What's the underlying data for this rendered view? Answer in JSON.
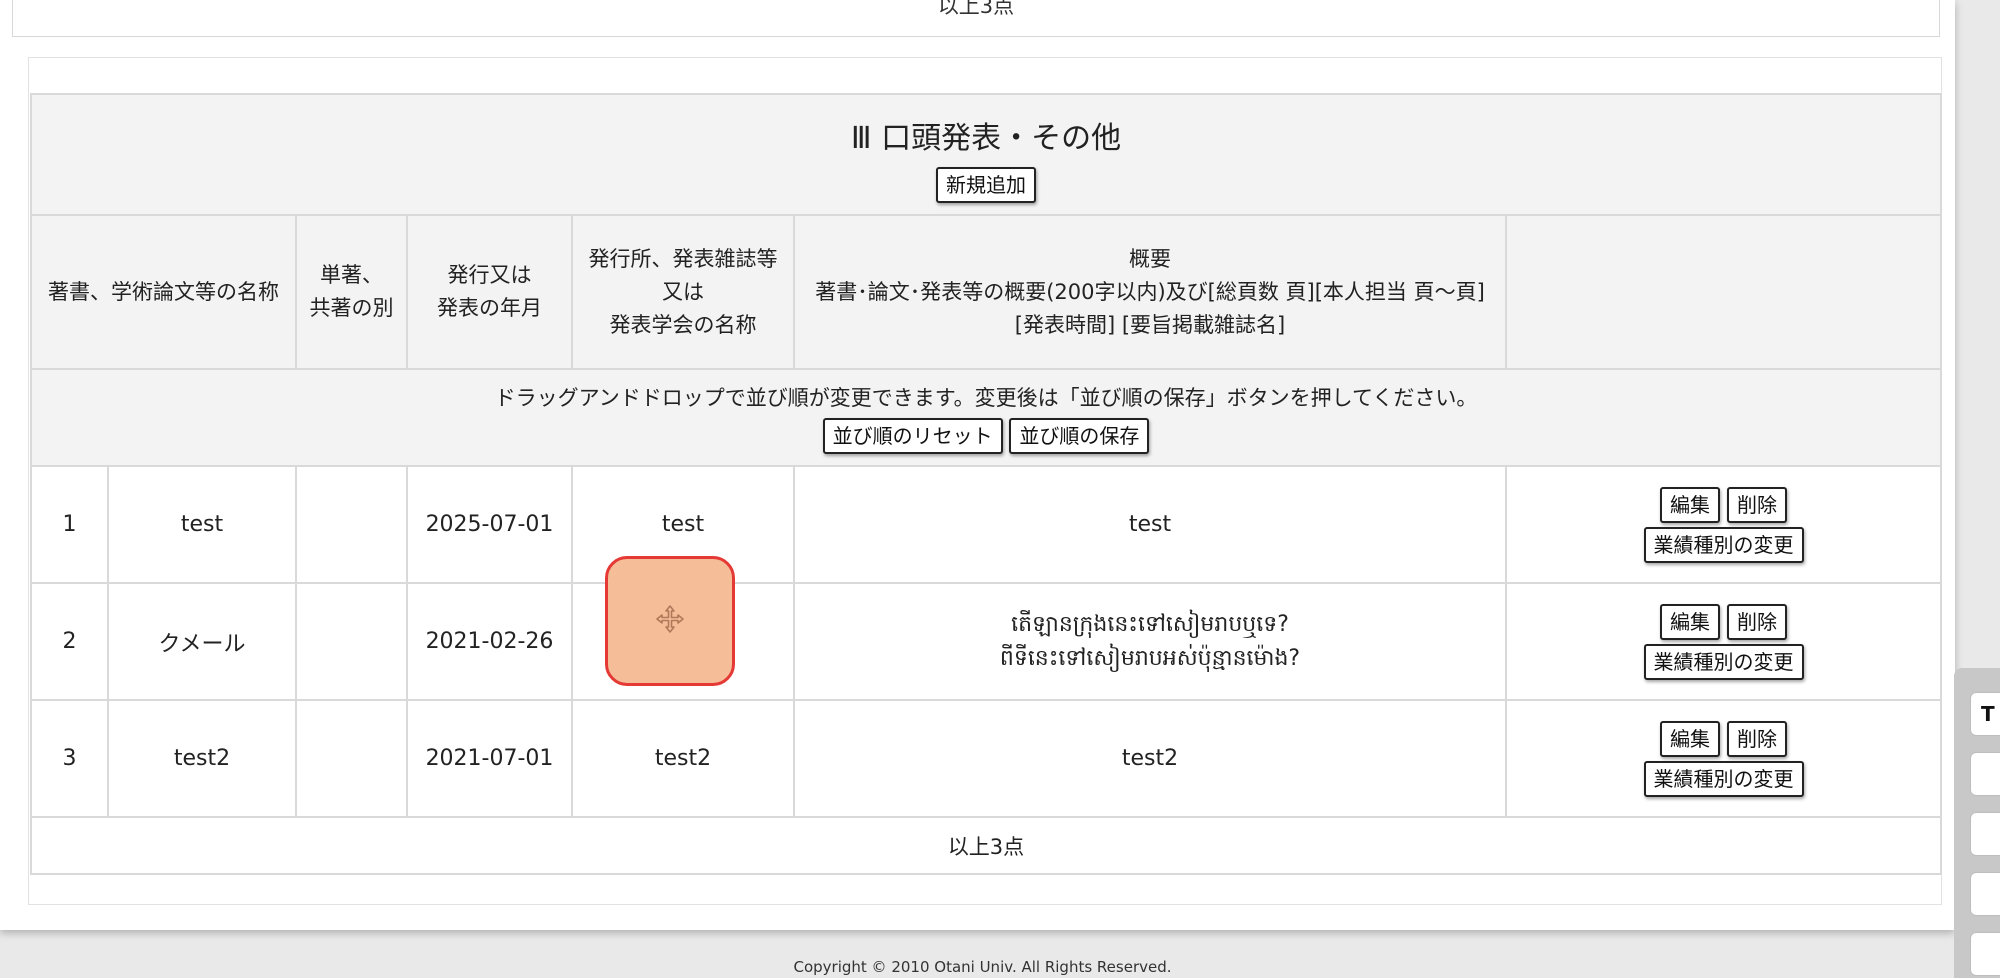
{
  "previous_section": {
    "footer_text": "以上3点"
  },
  "section": {
    "title": "Ⅲ 口頭発表・その他",
    "add_button": "新規追加",
    "columns": {
      "name": "著書、学術論文等の名称",
      "authorship": [
        "単著、",
        "共著の別"
      ],
      "date": [
        "発行又は",
        "発表の年月"
      ],
      "publisher": [
        "発行所、発表雑誌等",
        "又は",
        "発表学会の名称"
      ],
      "summary": [
        "概要",
        "著書･論文･発表等の概要(200字以内)及び[総頁数 頁][本人担当 頁～頁]",
        "[発表時間] [要旨掲載雑誌名]"
      ]
    },
    "dnd_instruction": "ドラッグアンドドロップで並び順が変更できます。変更後は「並び順の保存」ボタンを押してください。",
    "reset_order_button": "並び順のリセット",
    "save_order_button": "並び順の保存",
    "rows": [
      {
        "no": "1",
        "name": "test",
        "authorship": "",
        "date": "2025-07-01",
        "publisher": "test",
        "summary": [
          "test"
        ]
      },
      {
        "no": "2",
        "name": "クメール",
        "authorship": "",
        "date": "2021-02-26",
        "publisher": "",
        "summary": [
          "តើឡានក្រុងនេះទៅសៀមរាបឬទេ?",
          "ពីទីនេះទៅសៀមរាបអស់ប៉ុន្មានម៉ោង?"
        ]
      },
      {
        "no": "3",
        "name": "test2",
        "authorship": "",
        "date": "2021-07-01",
        "publisher": "test2",
        "summary": [
          "test2"
        ]
      }
    ],
    "edit_button": "編集",
    "delete_button": "削除",
    "change_type_button": "業績種別の変更",
    "footer_text": "以上3点"
  },
  "copyright": "Copyright © 2010 Otani Univ. All Rights Reserved.",
  "side_dock": {
    "first_label": "T"
  },
  "colors": {
    "drag_fill": "#f5bd98",
    "drag_border": "#e53935",
    "header_bg": "#f3f3f3"
  }
}
